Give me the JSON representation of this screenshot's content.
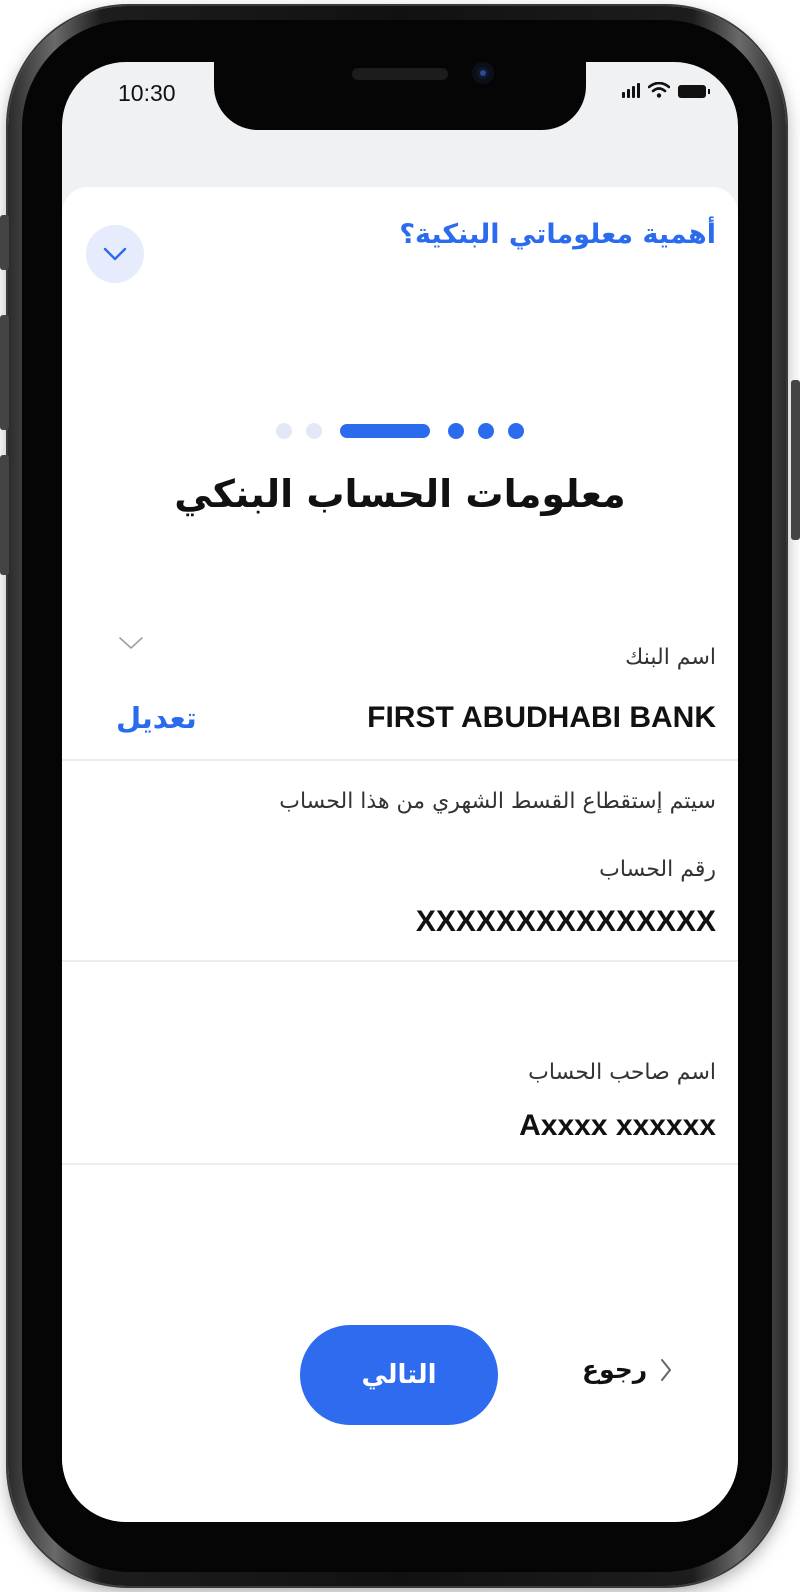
{
  "status_bar": {
    "time": "10:30"
  },
  "header": {
    "faq_title": "أهمية معلوماتي البنكية؟"
  },
  "stepper": {
    "total_steps": 7,
    "current_step": 3,
    "completed_steps": 2
  },
  "page": {
    "title": "معلومات الحساب البنكي"
  },
  "bank": {
    "label": "اسم البنك",
    "value": "FIRST ABUDHABI BANK",
    "edit_label": "تعديل",
    "note": "سيتم إستقطاع القسط الشهري من هذا الحساب"
  },
  "account_number": {
    "label": "رقم الحساب",
    "value": "XXXXXXXXXXXXXXX"
  },
  "account_holder": {
    "label": "اسم صاحب الحساب",
    "value": "Axxxx xxxxxx"
  },
  "footer": {
    "next_label": "التالي",
    "back_label": "رجوع"
  },
  "colors": {
    "accent": "#2B6BEE",
    "accent_light": "#E6ECFB",
    "text": "#111111"
  },
  "icons": {
    "collapse": "chevron-down-icon",
    "bank_dropdown": "chevron-down-icon",
    "back": "chevron-right-icon",
    "signal": "signal-icon",
    "wifi": "wifi-icon",
    "battery": "battery-icon"
  }
}
